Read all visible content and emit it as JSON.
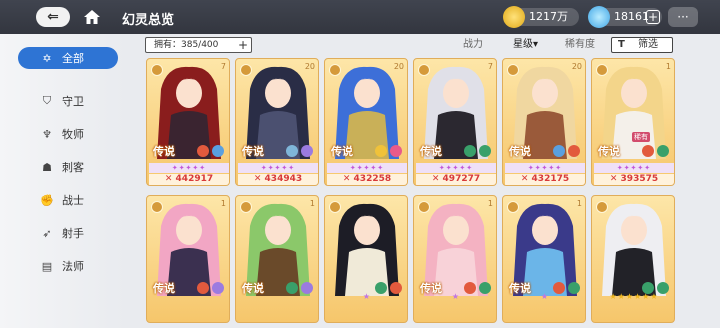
{
  "header": {
    "title": "幻灵总览",
    "gold": "1217万",
    "gems": "18161",
    "gem_plus": "+",
    "chat_icon": "chat-bubble-icon"
  },
  "sidebar": {
    "items": [
      {
        "label": "全部",
        "icon": "star-outline-icon",
        "active": true
      },
      {
        "label": "守卫",
        "icon": "shield-icon",
        "active": false
      },
      {
        "label": "牧师",
        "icon": "wings-icon",
        "active": false
      },
      {
        "label": "刺客",
        "icon": "skull-icon",
        "active": false
      },
      {
        "label": "战士",
        "icon": "fist-icon",
        "active": false
      },
      {
        "label": "射手",
        "icon": "bow-icon",
        "active": false
      },
      {
        "label": "法师",
        "icon": "book-icon",
        "active": false
      }
    ]
  },
  "filter_bar": {
    "owned": "拥有：385/400",
    "plus": "+",
    "sort_power": "战力",
    "sort_star": "星级▾",
    "sort_rarity": "稀有度",
    "filter_label": "筛选",
    "filter_icon": "T"
  },
  "cards_row1": [
    {
      "count": "7",
      "legend": "传说",
      "power": "✕ 442917",
      "stars": "✦✦✦✦✦",
      "hair": "#8a1d1d",
      "outfit": "#3a2430",
      "e1": "#e25a3d",
      "e2": "#5aa0e0"
    },
    {
      "count": "20",
      "legend": "传说",
      "power": "✕ 434943",
      "stars": "✦✦✦✦✦",
      "hair": "#2a2d46",
      "outfit": "#4b5070",
      "e1": "#7fb6d9",
      "e2": "#9b7be0"
    },
    {
      "count": "20",
      "legend": "传说",
      "power": "✕ 432258",
      "stars": "✦✦✦✦✦",
      "hair": "#3d6fd8",
      "outfit": "#c9b058",
      "e1": "#f0c23a",
      "e2": "#e85a8a"
    },
    {
      "count": "7",
      "legend": "传说",
      "power": "✕ 497277",
      "stars": "✦✦✦✦✦",
      "hair": "#e0e0e8",
      "outfit": "#2b2830",
      "e1": "#39a06a",
      "e2": "#39a06a"
    },
    {
      "count": "20",
      "legend": "传说",
      "power": "✕ 432175",
      "stars": "✦✦✦✦✦",
      "hair": "#f0d7a0",
      "outfit": "#9a5a3a",
      "e1": "#5aa0e0",
      "e2": "#e25a3d"
    },
    {
      "count": "1",
      "legend": "传说",
      "power": "✕ 393575",
      "stars": "✦✦✦✦✦",
      "hair": "#f3d58a",
      "outfit": "#f4f0ea",
      "e1": "#e25a3d",
      "e2": "#39a06a",
      "tag": "稀有"
    }
  ],
  "cards_row2": [
    {
      "count": "1",
      "legend": "传说",
      "stars": "",
      "hair": "#f2a6c4",
      "outfit": "#3b3050",
      "e1": "#e25a3d",
      "e2": "#9b7be0"
    },
    {
      "count": "1",
      "legend": "传说",
      "stars": "",
      "hair": "#8bc86a",
      "outfit": "#6a4a2a",
      "e1": "#39a06a",
      "e2": "#9b7be0"
    },
    {
      "count": "",
      "legend": "",
      "stars": "★",
      "hair": "#1d1d26",
      "outfit": "#f0ead8",
      "e1": "#39a06a",
      "e2": "#e25a3d"
    },
    {
      "count": "1",
      "legend": "传说",
      "stars": "★",
      "hair": "#f4b2c2",
      "outfit": "#f8d2d8",
      "e1": "#e25a3d",
      "e2": "#39a06a"
    },
    {
      "count": "1",
      "legend": "传说",
      "stars": "★",
      "hair": "#3a3a8a",
      "outfit": "#6bb5e8",
      "e1": "#e25a3d",
      "e2": "#39a06a"
    },
    {
      "count": "",
      "legend": "",
      "stars": "★★★★★★",
      "hair": "#eeeef2",
      "outfit": "#222228",
      "e1": "#39a06a",
      "e2": "#39a06a"
    }
  ]
}
